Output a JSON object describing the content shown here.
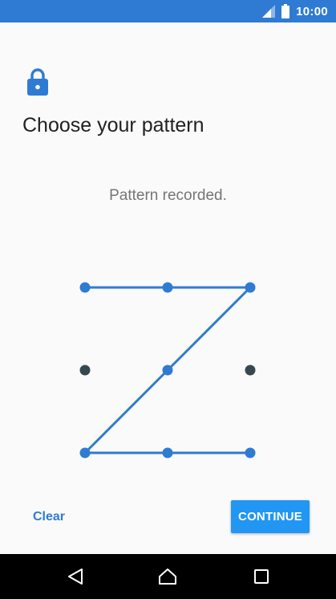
{
  "status_bar": {
    "time": "10:00",
    "icons": [
      "signal-icon",
      "battery-icon"
    ]
  },
  "header": {
    "icon": "lock-icon",
    "title": "Choose your pattern"
  },
  "pattern": {
    "status": "Pattern recorded.",
    "grid_rows": 3,
    "grid_cols": 3,
    "selected_sequence": [
      1,
      2,
      3,
      5,
      7,
      8,
      9
    ]
  },
  "actions": {
    "clear_label": "Clear",
    "continue_label": "CONTINUE"
  },
  "navigation": {
    "buttons": [
      "back-icon",
      "home-icon",
      "recent-apps-icon"
    ]
  },
  "colors": {
    "status_bar": "#2f7bd3",
    "accent": "#2f7bd3",
    "button": "#2196f3",
    "dot_inactive": "#37474f",
    "background": "#fafafa"
  }
}
